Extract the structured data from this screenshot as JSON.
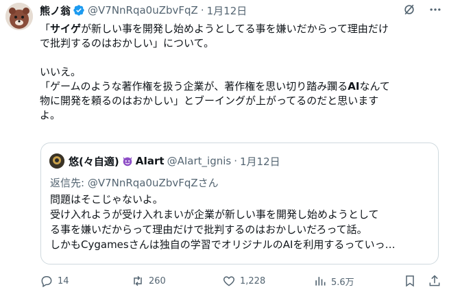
{
  "author": {
    "display_name": "熊ノ翁",
    "handle": "@V7NnRqa0uZbvFqZ",
    "separator": "·",
    "date": "1月12日",
    "verified": true
  },
  "tweet": {
    "line1_pre": "「",
    "line1_bold": "サイゲ",
    "line1_post": "が新しい事を開発し始めようとしてる事を嫌いだからって理由だけ",
    "line2": "で批判するのはおかしい」について。",
    "line3": "いいえ。",
    "line4_pre": "「ゲームのような著作権を扱う企業が、著作権を思い切り踏み躙る",
    "line4_bold": "AI",
    "line4_post": "なんて",
    "line5": "物に開発を頼るのはおかしい」とブーイングが上がってるのだと思います",
    "line6": "よ。"
  },
  "quote": {
    "display_name": "悠(々自適)",
    "name_suffix": "AIart",
    "handle": "@AIart_ignis",
    "separator": "·",
    "date": "1月12日",
    "reply_to": "返信先: @V7NnRqa0uZbvFqZさん",
    "text_lines": [
      "問題はそこじゃないよ。",
      "受け入れようが受け入れまいが企業が新しい事を開発し始めようとして",
      "る事を嫌いだからって理由だけで批判するのはおかしいだろって話。",
      "しかもCygamesさんは独自の学習でオリジナルのAIを利用するっていっ…"
    ]
  },
  "actions": {
    "replies": "14",
    "reposts": "260",
    "likes": "1,228",
    "views": "5.6万"
  },
  "icons": {
    "verified": "verified-badge-icon",
    "grok": "grok-icon",
    "more": "more-icon",
    "reply": "reply-icon",
    "repost": "repost-icon",
    "like": "like-icon",
    "views": "views-icon",
    "bookmark": "bookmark-icon",
    "share": "share-icon"
  },
  "colors": {
    "text": "#0f1419",
    "secondary": "#536471",
    "verified": "#1d9bf0",
    "border": "#cfd9de"
  }
}
